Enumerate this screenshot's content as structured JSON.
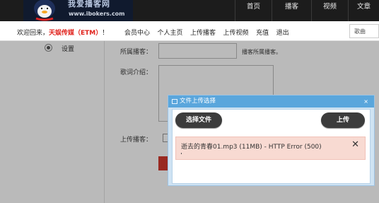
{
  "header": {
    "logo_text": "我爱播客网",
    "logo_url": "www.ibokers.com",
    "nav": [
      "首页",
      "播客",
      "视频",
      "文章"
    ]
  },
  "userbar": {
    "welcome_prefix": "欢迎回来，",
    "brand": "天娱传媒（ETM）",
    "welcome_suffix": "！",
    "links": [
      "会员中心",
      "个人主页",
      "上传播客",
      "上传视频",
      "充值",
      "退出"
    ],
    "search_type": "歌曲"
  },
  "sidebar": {
    "settings_label": "设置"
  },
  "form": {
    "owner_label": "所属播客：",
    "owner_hint": "播客所属播客。",
    "lyrics_label": "歌词介绍：",
    "upload_label": "上传播客："
  },
  "dialog": {
    "title": "文件上传选择",
    "close_label": "×",
    "choose_button": "选择文件",
    "upload_button": "上传",
    "file_entry": "逝去的青春01.mp3 (11MB) - HTTP Error (500)",
    "remove_label": "✕"
  },
  "colors": {
    "accent_red": "#e0211b",
    "dialog_title_bg": "#5aa6dc",
    "error_row_bg": "#f8dad2"
  }
}
